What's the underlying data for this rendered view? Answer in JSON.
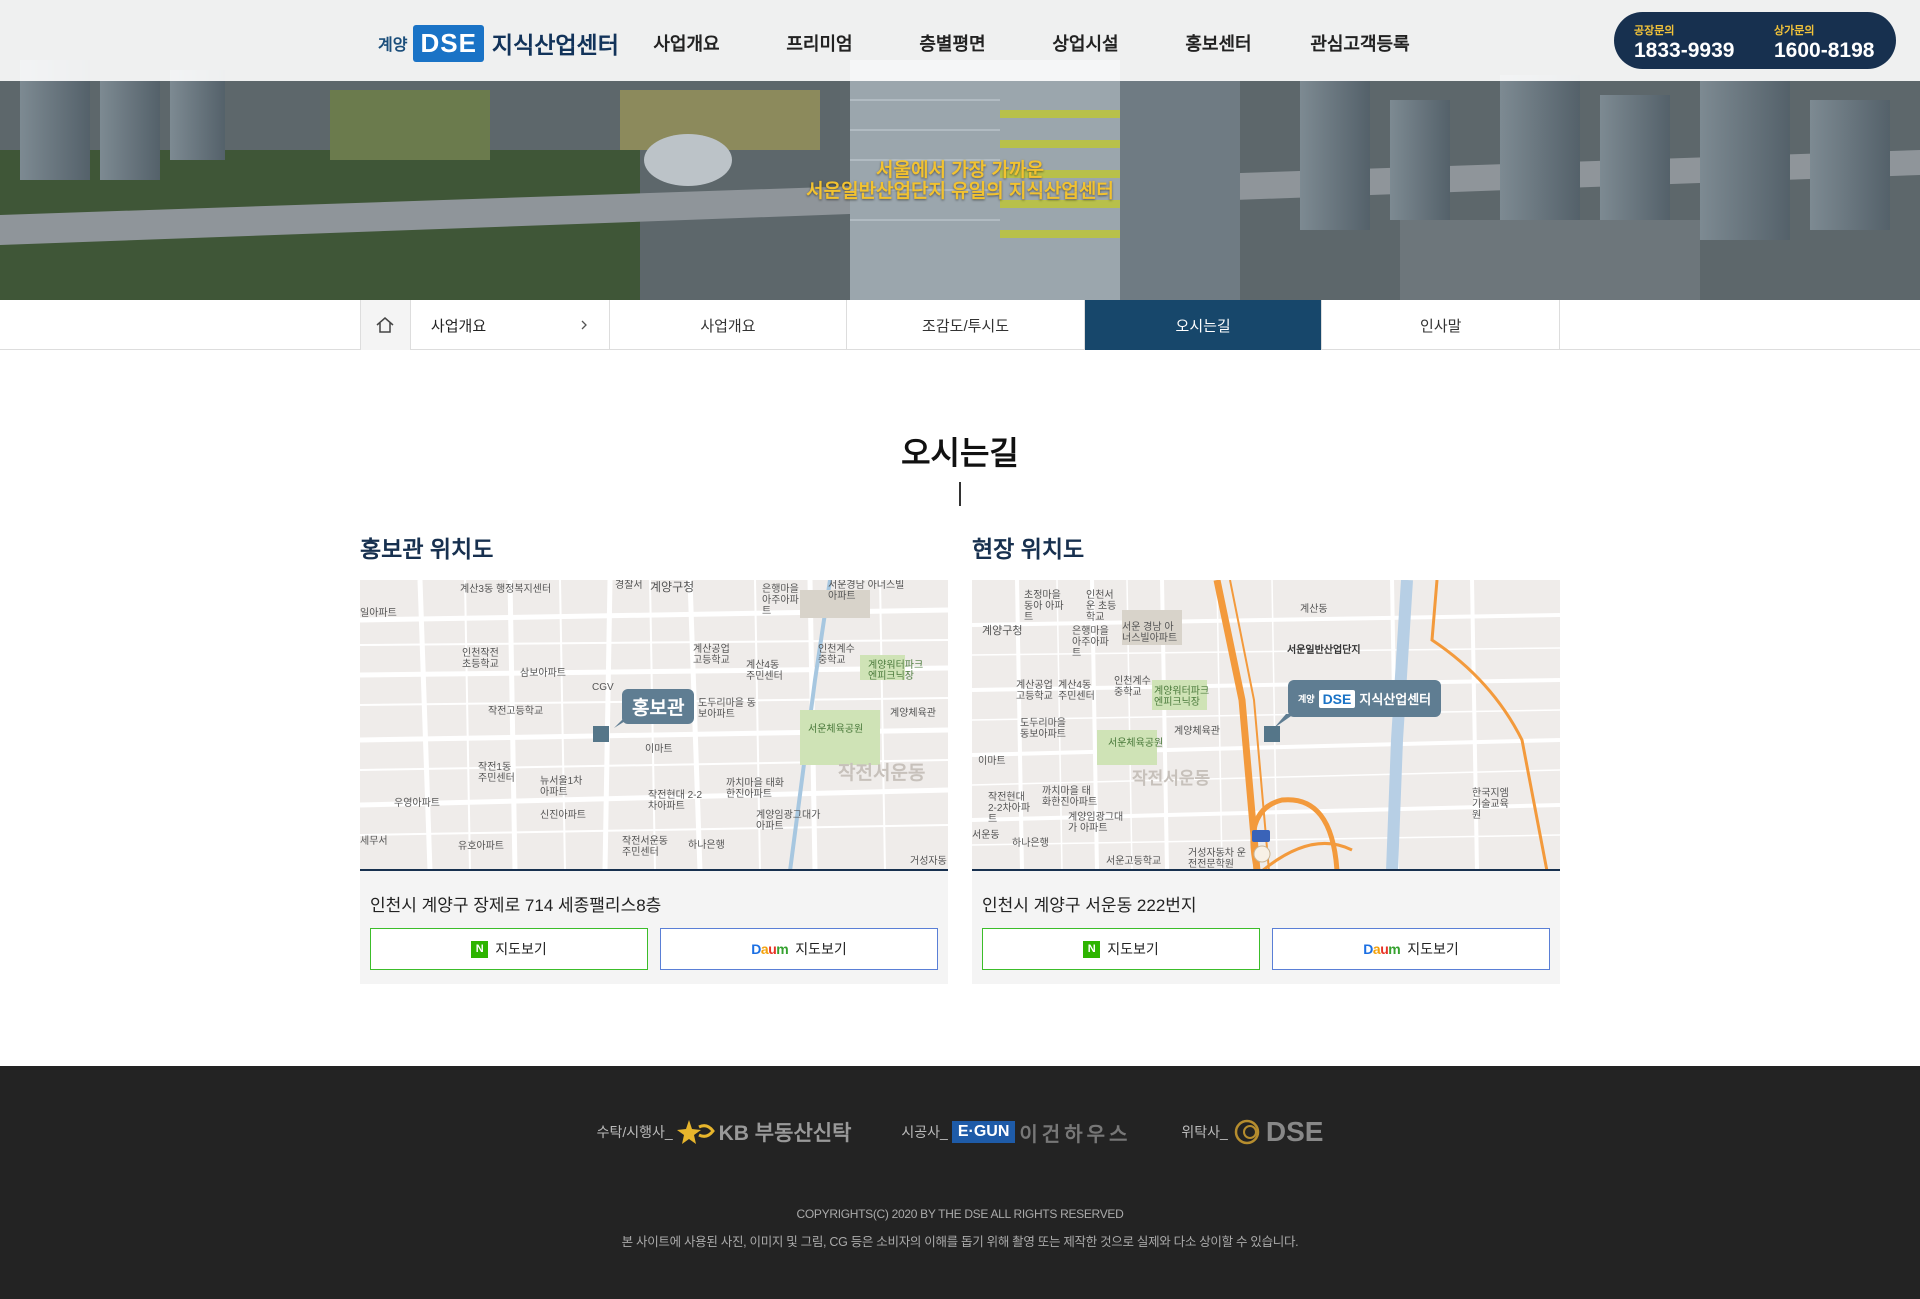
{
  "header": {
    "logo_prefix": "계양",
    "logo_mark": "DSE",
    "logo_name": "지식산업센터",
    "nav": [
      "사업개요",
      "프리미엄",
      "층별평면",
      "상업시설",
      "홍보센터",
      "관심고객등록"
    ],
    "phones": [
      {
        "label": "공장문의",
        "number": "1833-9939"
      },
      {
        "label": "상가문의",
        "number": "1600-8198"
      }
    ]
  },
  "hero": {
    "tagline_1": "서울에서 가장 가까운",
    "tagline_2": "서운일반산업단지 유일의 지식산업센터"
  },
  "subnav": {
    "home_icon": "home-icon",
    "current": "사업개요",
    "tabs": [
      "사업개요",
      "조감도/투시도",
      "오시는길",
      "인사말"
    ],
    "active": "오시는길"
  },
  "main": {
    "title": "오시는길",
    "locations": [
      {
        "heading": "홍보관 위치도",
        "pin": "홍보관",
        "address": "인천시 계양구 장제로 714 세종팰리스8층",
        "naver_label": "지도보기",
        "daum_label": "지도보기",
        "map_labels": [
          "계산3동 행정복지센터",
          "경찰서",
          "계양구청",
          "은행마을 아주아파트",
          "서운경남 아너스빌아파트",
          "일아파트",
          "인천작전 초등학교",
          "삼보아파트",
          "계산공업 고등학교",
          "계산4동 주민센터",
          "인천계수 중학교",
          "계양워터파크 엔피크닉장",
          "CGV",
          "도두리마을 동보아파트",
          "작전고등학교",
          "서운체육공원",
          "계양체육관",
          "이마트",
          "작전서운동",
          "작전1동 주민센터",
          "뉴서울1차 아파트",
          "까치마을 태화한진아파트",
          "우영아파트",
          "작전현대 2-2차아파트",
          "신진아파트",
          "계양임광그대가 아파트",
          "세무서",
          "작전서운동 주민센터",
          "하나은행",
          "유호아파트",
          "거성자동"
        ]
      },
      {
        "heading": "현장 위치도",
        "pin_prefix": "계양",
        "pin_mark": "DSE",
        "pin_name": "지식산업센터",
        "address": "인천시 계양구 서운동 222번지",
        "naver_label": "지도보기",
        "daum_label": "지도보기",
        "map_labels": [
          "초정마을동아 아파트",
          "인천서운 초등학교",
          "계산동",
          "계양구청",
          "은행마을 아주아파트",
          "서운 경남 아너스빌아파트",
          "서운일반산업단지",
          "계산공업 고등학교",
          "계산4동 주민센터",
          "인천계수 중학교",
          "계양워터파크 엔피크닉장",
          "도두리마을 동보아파트",
          "계양체육관",
          "서운체육공원",
          "이마트",
          "작전서운동",
          "작전현대 2-2차아파트",
          "까치마을 태화한진아파트",
          "계양임광그대가 아파트",
          "한국지엠 기술교육원",
          "서운동",
          "하나은행",
          "서운고등학교",
          "거성자동차 운전전문학원"
        ]
      }
    ]
  },
  "footer": {
    "partners": [
      {
        "role": "수탁/시행사_",
        "name": "KB 부동산신탁"
      },
      {
        "role": "시공사_",
        "mark": "E·GUN",
        "name": "이건하우스"
      },
      {
        "role": "위탁사_",
        "name": "DSE"
      }
    ],
    "copyright": "COPYRIGHTS(C) 2020 BY THE DSE ALL RIGHTS RESERVED",
    "notice": "본 사이트에 사용된 사진, 이미지 및 그림, CG 등은 소비자의 이해를 돕기 위해 촬영 또는 제작한 것으로 실제와 다소 상이할 수 있습니다."
  },
  "colors": {
    "accent_navy": "#17476b",
    "tel_bg": "#17304f",
    "tagline_gold": "#f2c230",
    "logo_blue": "#1a73c6",
    "footer_bg": "#232323"
  }
}
